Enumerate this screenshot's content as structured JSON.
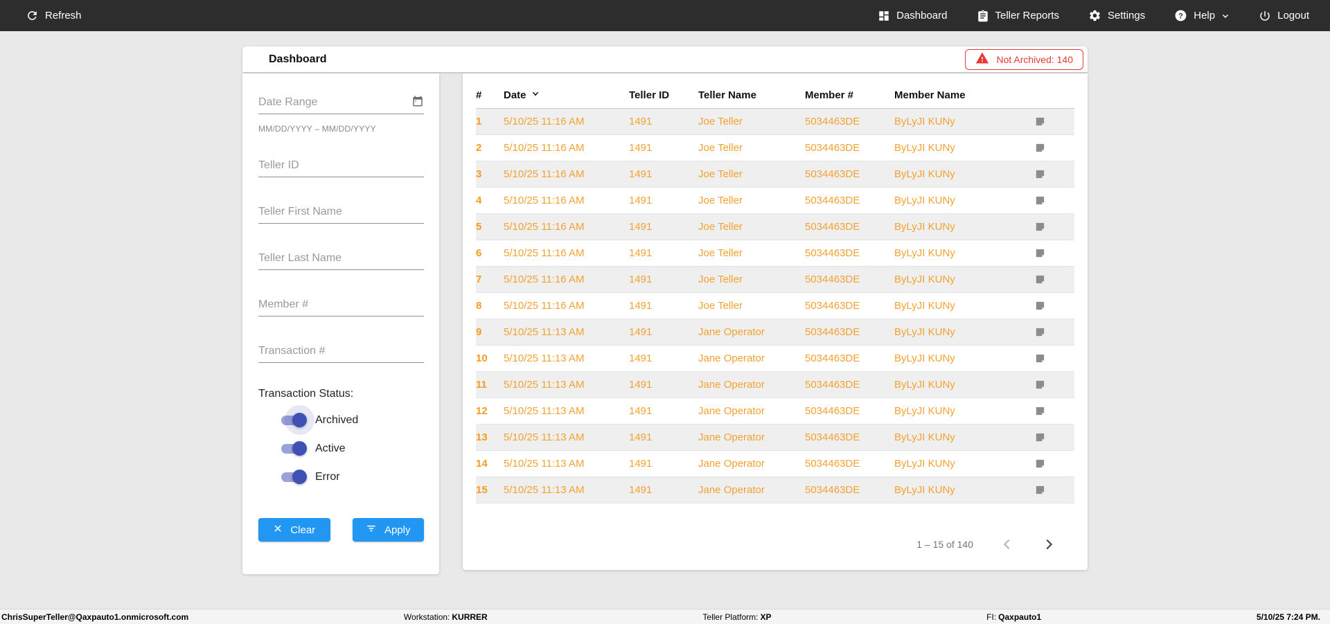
{
  "topbar": {
    "refresh_label": "Refresh",
    "nav": [
      {
        "label": "Dashboard",
        "icon": "dashboard-icon"
      },
      {
        "label": "Teller Reports",
        "icon": "reports-icon"
      },
      {
        "label": "Settings",
        "icon": "settings-icon"
      },
      {
        "label": "Help",
        "icon": "help-icon",
        "has_dropdown": true
      },
      {
        "label": "Logout",
        "icon": "logout-icon"
      }
    ]
  },
  "header": {
    "title": "Dashboard",
    "not_archived_badge": "Not Archived: 140"
  },
  "filters": {
    "date_range": {
      "placeholder": "Date Range",
      "hint": "MM/DD/YYYY – MM/DD/YYYY",
      "icon": "calendar-icon"
    },
    "teller_id_placeholder": "Teller ID",
    "teller_first_name_placeholder": "Teller First Name",
    "teller_last_name_placeholder": "Teller Last Name",
    "member_number_placeholder": "Member #",
    "transaction_number_placeholder": "Transaction #",
    "status_label": "Transaction Status:",
    "toggles": [
      {
        "label": "Archived",
        "on": true
      },
      {
        "label": "Active",
        "on": true
      },
      {
        "label": "Error",
        "on": true
      }
    ],
    "clear_label": "Clear",
    "apply_label": "Apply"
  },
  "table": {
    "columns": {
      "num": "#",
      "date": "Date",
      "teller_id": "Teller ID",
      "teller_name": "Teller Name",
      "member_num": "Member #",
      "member_name": "Member Name"
    },
    "sort": {
      "column": "Date",
      "direction": "desc"
    },
    "rows": [
      {
        "num": "1",
        "date": "5/10/25 11:16 AM",
        "teller_id": "1491",
        "teller_name": "Joe Teller",
        "member_num": "5034463DE",
        "member_name": "ByLyJI KUNy"
      },
      {
        "num": "2",
        "date": "5/10/25 11:16 AM",
        "teller_id": "1491",
        "teller_name": "Joe Teller",
        "member_num": "5034463DE",
        "member_name": "ByLyJI KUNy"
      },
      {
        "num": "3",
        "date": "5/10/25 11:16 AM",
        "teller_id": "1491",
        "teller_name": "Joe Teller",
        "member_num": "5034463DE",
        "member_name": "ByLyJI KUNy"
      },
      {
        "num": "4",
        "date": "5/10/25 11:16 AM",
        "teller_id": "1491",
        "teller_name": "Joe Teller",
        "member_num": "5034463DE",
        "member_name": "ByLyJI KUNy"
      },
      {
        "num": "5",
        "date": "5/10/25 11:16 AM",
        "teller_id": "1491",
        "teller_name": "Joe Teller",
        "member_num": "5034463DE",
        "member_name": "ByLyJI KUNy"
      },
      {
        "num": "6",
        "date": "5/10/25 11:16 AM",
        "teller_id": "1491",
        "teller_name": "Joe Teller",
        "member_num": "5034463DE",
        "member_name": "ByLyJI KUNy"
      },
      {
        "num": "7",
        "date": "5/10/25 11:16 AM",
        "teller_id": "1491",
        "teller_name": "Joe Teller",
        "member_num": "5034463DE",
        "member_name": "ByLyJI KUNy"
      },
      {
        "num": "8",
        "date": "5/10/25 11:16 AM",
        "teller_id": "1491",
        "teller_name": "Joe Teller",
        "member_num": "5034463DE",
        "member_name": "ByLyJI KUNy"
      },
      {
        "num": "9",
        "date": "5/10/25 11:13 AM",
        "teller_id": "1491",
        "teller_name": "Jane Operator",
        "member_num": "5034463DE",
        "member_name": "ByLyJI KUNy"
      },
      {
        "num": "10",
        "date": "5/10/25 11:13 AM",
        "teller_id": "1491",
        "teller_name": "Jane Operator",
        "member_num": "5034463DE",
        "member_name": "ByLyJI KUNy"
      },
      {
        "num": "11",
        "date": "5/10/25 11:13 AM",
        "teller_id": "1491",
        "teller_name": "Jane Operator",
        "member_num": "5034463DE",
        "member_name": "ByLyJI KUNy"
      },
      {
        "num": "12",
        "date": "5/10/25 11:13 AM",
        "teller_id": "1491",
        "teller_name": "Jane Operator",
        "member_num": "5034463DE",
        "member_name": "ByLyJI KUNy"
      },
      {
        "num": "13",
        "date": "5/10/25 11:13 AM",
        "teller_id": "1491",
        "teller_name": "Jane Operator",
        "member_num": "5034463DE",
        "member_name": "ByLyJI KUNy"
      },
      {
        "num": "14",
        "date": "5/10/25 11:13 AM",
        "teller_id": "1491",
        "teller_name": "Jane Operator",
        "member_num": "5034463DE",
        "member_name": "ByLyJI KUNy"
      },
      {
        "num": "15",
        "date": "5/10/25 11:13 AM",
        "teller_id": "1491",
        "teller_name": "Jane Operator",
        "member_num": "5034463DE",
        "member_name": "ByLyJI KUNy"
      }
    ],
    "row_action_icon": "note-icon",
    "pagination": {
      "range_label": "1 – 15 of 140"
    }
  },
  "footer": {
    "user": "ChrisSuperTeller@Qaxpauto1.onmicrosoft.com",
    "workstation_label": "Workstation:",
    "workstation": "KURRER",
    "platform_label": "Teller Platform:",
    "platform": "XP",
    "fi_label": "FI:",
    "fi": "Qaxpauto1",
    "datetime": "5/10/25 7:24 PM."
  },
  "colors": {
    "topbar_bg": "#2d2d2d",
    "page_bg": "#e9e9e9",
    "accent_blue": "#2196f3",
    "toggle_indigo": "#3f51b5",
    "row_orange": "#f2a230",
    "alert_red": "#e53935",
    "stripe_gray": "#efefef"
  }
}
